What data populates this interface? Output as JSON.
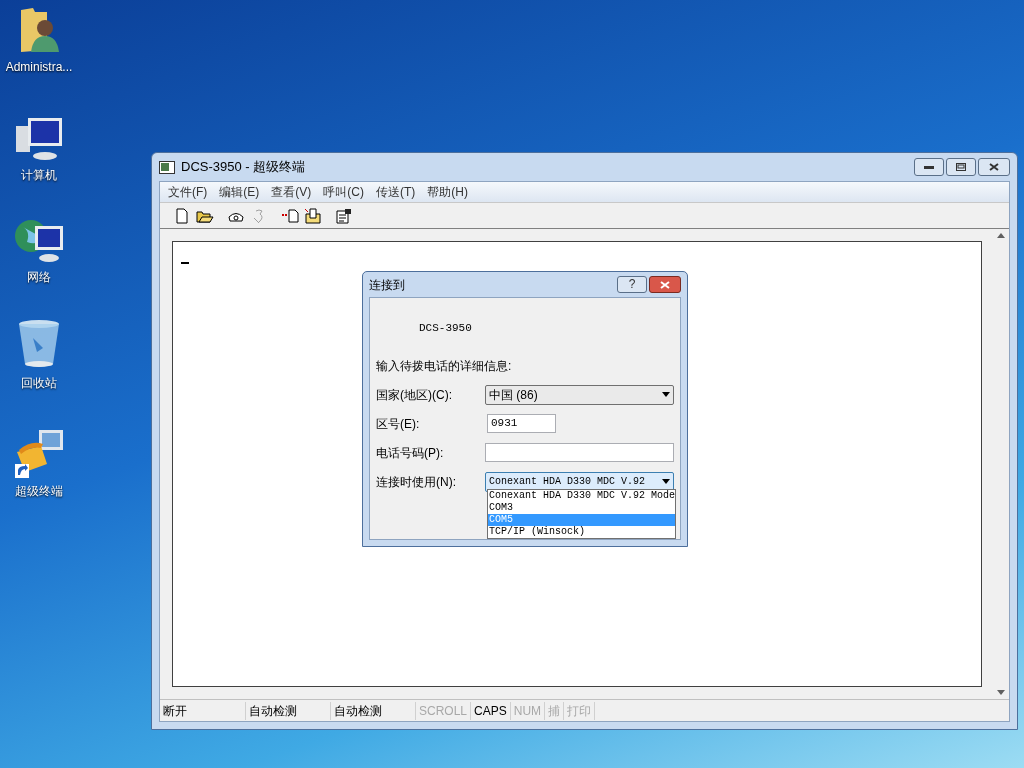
{
  "desktop_icons": [
    {
      "kind": "user-folder",
      "label": "Administra..."
    },
    {
      "kind": "computer",
      "label": "计算机"
    },
    {
      "kind": "network",
      "label": "网络"
    },
    {
      "kind": "recycle-bin",
      "label": "回收站"
    },
    {
      "kind": "terminal-shortcut",
      "label": "超级终端"
    }
  ],
  "window": {
    "title": "DCS-3950 - 超级终端",
    "menu": [
      "文件(F)",
      "编辑(E)",
      "查看(V)",
      "呼叫(C)",
      "传送(T)",
      "帮助(H)"
    ],
    "toolbar": [
      {
        "kind": "new",
        "disabled": false
      },
      {
        "kind": "open",
        "disabled": false
      },
      {
        "kind": "dial",
        "disabled": false
      },
      {
        "kind": "hangup",
        "disabled": true
      },
      {
        "kind": "send",
        "disabled": false
      },
      {
        "kind": "receive",
        "disabled": false
      },
      {
        "kind": "properties",
        "disabled": false
      }
    ],
    "status_bar": [
      {
        "text": "断开",
        "on": true
      },
      {
        "text": "自动检测",
        "on": true
      },
      {
        "text": "自动检测",
        "on": true
      },
      {
        "text": "SCROLL",
        "on": false
      },
      {
        "text": "CAPS",
        "on": true
      },
      {
        "text": "NUM",
        "on": false
      },
      {
        "text": "捕",
        "on": false
      },
      {
        "text": "打印",
        "on": false
      }
    ]
  },
  "dialog": {
    "title": "连接到",
    "help": "?",
    "connection_name": "DCS-3950",
    "prompt": "输入待拨电话的详细信息:",
    "fields": [
      {
        "kind": "select",
        "label": "国家(地区)(C):",
        "value": "中国 (86)"
      },
      {
        "kind": "input",
        "label": "区号(E):",
        "value": "0931"
      },
      {
        "kind": "input",
        "label": "电话号码(P):"
      },
      {
        "kind": "select",
        "label": "连接时使用(N):",
        "value": "Conexant HDA D330 MDC V.92",
        "open": true
      }
    ],
    "dropdown_options": [
      {
        "text": "Conexant HDA D330 MDC V.92 Mode",
        "selected": false
      },
      {
        "text": "COM3",
        "selected": false
      },
      {
        "text": "COM5",
        "selected": true
      },
      {
        "text": "TCP/IP (Winsock)",
        "selected": false
      }
    ]
  }
}
